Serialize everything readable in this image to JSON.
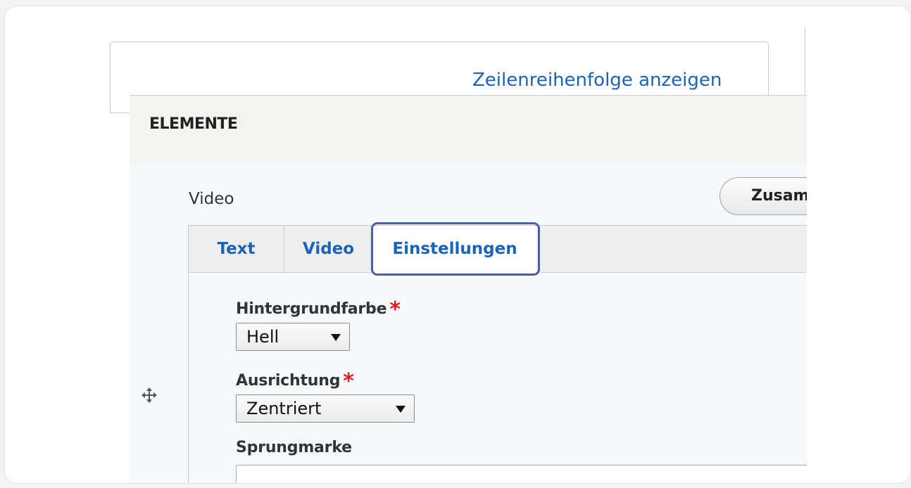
{
  "toolbar": {
    "row_order_link": "Zeilenreihenfolge anzeigen"
  },
  "section": {
    "title": "ELEMENTE"
  },
  "item": {
    "label": "Video",
    "collapse_button": "Zusam"
  },
  "tabs": [
    {
      "label": "Text",
      "active": false
    },
    {
      "label": "Video",
      "active": false
    },
    {
      "label": "Einstellungen",
      "active": true
    }
  ],
  "fields": {
    "background": {
      "label": "Hintergrundfarbe",
      "required_mark": "*",
      "value": "Hell"
    },
    "alignment": {
      "label": "Ausrichtung",
      "required_mark": "*",
      "value": "Zentriert"
    },
    "anchor": {
      "label": "Sprungmarke",
      "value": ""
    }
  },
  "colors": {
    "link": "#1b63b6",
    "required": "#e02020",
    "highlight": "#4c5ea6",
    "panel_bg": "#f3f9fd"
  },
  "icons": {
    "drag_handle": "move-arrows-icon",
    "select_caret": "caret-down-icon"
  }
}
